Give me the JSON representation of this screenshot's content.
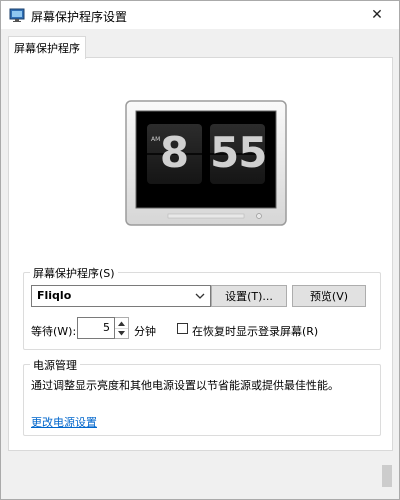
{
  "window": {
    "title": "屏幕保护程序设置",
    "close_glyph": "✕"
  },
  "tabs": [
    {
      "label": "屏幕保护程序"
    }
  ],
  "preview": {
    "am_label": "AM",
    "hour": "8",
    "minutes": "55"
  },
  "screensaver": {
    "group_label": "屏幕保护程序(S)",
    "selected": "Fliqlo",
    "settings_button": "设置(T)...",
    "preview_button": "预览(V)",
    "wait_label": "等待(W):",
    "wait_value": "5",
    "minutes_label": "分钟",
    "resume_checkbox_label": "在恢复时显示登录屏幕(R)",
    "resume_checked": false
  },
  "power": {
    "group_label": "电源管理",
    "description": "通过调整显示亮度和其他电源设置以节省能源或提供最佳性能。",
    "link": "更改电源设置"
  },
  "colors": {
    "link": "#0066cc",
    "window_bg": "#f0f0f0",
    "panel_bg": "#ffffff",
    "button_bg": "#e1e1e1"
  }
}
